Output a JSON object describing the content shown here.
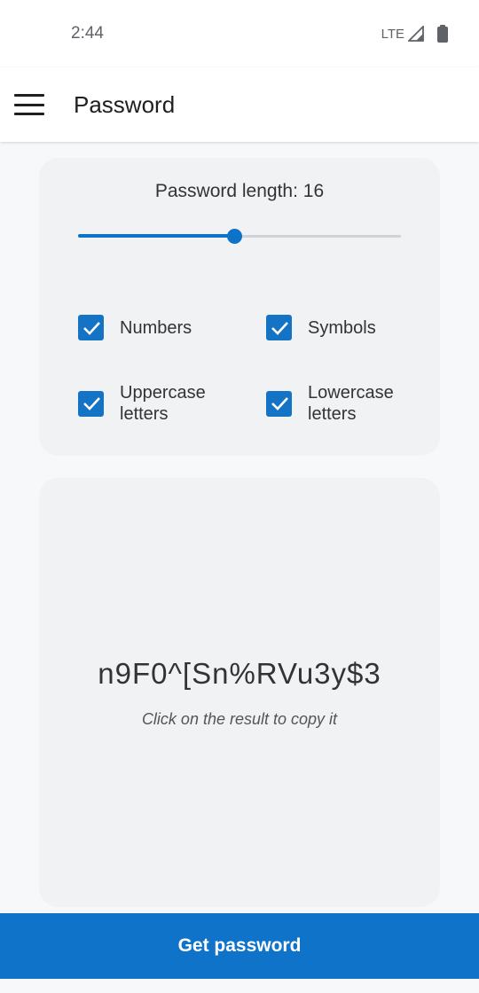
{
  "status_bar": {
    "time": "2:44",
    "network": "LTE",
    "icons": [
      "signal-icon",
      "battery-icon"
    ]
  },
  "app_bar": {
    "menu_icon": "menu-icon",
    "title": "Password"
  },
  "settings": {
    "length_label": "Password length: 16",
    "length_value": 16,
    "slider_fraction": 0.483,
    "options": {
      "numbers": {
        "label": "Numbers",
        "checked": true
      },
      "symbols": {
        "label": "Symbols",
        "checked": true
      },
      "uppercase": {
        "label": "Uppercase\nletters",
        "checked": true
      },
      "lowercase": {
        "label": "Lowercase\nletters",
        "checked": true
      }
    }
  },
  "result": {
    "password": "n9F0^[Sn%RVu3y$3",
    "hint": "Click on the result to copy it"
  },
  "action": {
    "button_label": "Get password"
  },
  "colors": {
    "accent": "#0f73c9",
    "card_background": "#f1f2f4",
    "page_background": "#f7f8fa"
  }
}
